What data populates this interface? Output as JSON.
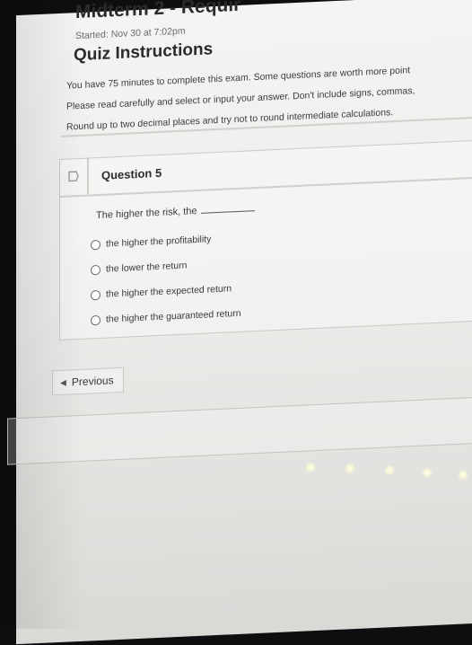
{
  "quiz": {
    "title": "Midterm 2 - Requir",
    "started": "Started: Nov 30 at 7:02pm"
  },
  "instructions": {
    "heading": "Quiz Instructions",
    "lines": [
      "You have 75 minutes to complete this exam. Some questions are worth more point",
      "Please read carefully and select or input your answer. Don't include signs, commas,",
      "Round up to two decimal places and try not to round intermediate calculations."
    ]
  },
  "question": {
    "label": "Question 5",
    "prompt": "The higher the risk, the",
    "options": [
      "the higher the profitability",
      "the lower the return",
      "the higher the expected return",
      "the higher the guaranteed return"
    ]
  },
  "navigation": {
    "previous_label": "Previous"
  },
  "icons": {
    "flag": "flag-icon",
    "previous": "chevron-left-icon",
    "radio": "radio-icon"
  }
}
